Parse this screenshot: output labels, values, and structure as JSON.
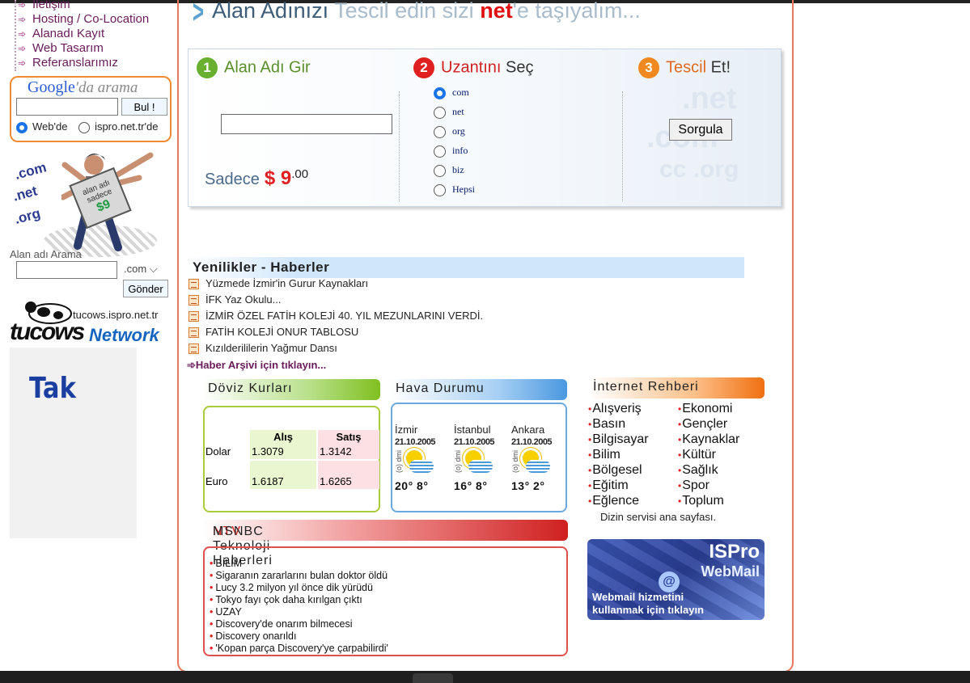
{
  "left_nav": {
    "items": [
      {
        "label": "İletişim"
      },
      {
        "label": "Hosting / Co-Location"
      },
      {
        "label": "Alanadı Kayıt"
      },
      {
        "label": "Web Tasarım"
      },
      {
        "label": "Referanslarımız"
      }
    ]
  },
  "google_search": {
    "logo_google": "Google",
    "logo_suffix": "'da arama",
    "button": "Bul !",
    "option_web": "Web'de",
    "option_site": "ispro.net.tr'de"
  },
  "promo": {
    "ext_com": ".com",
    "ext_net": ".net",
    "ext_org": ".org",
    "sign_line1": "alan adı",
    "sign_line2": "sadece",
    "sign_price": "$9"
  },
  "domain_search": {
    "label": "Alan adı Arama",
    "ext_select": ".com",
    "button": "Gönder"
  },
  "tucows": {
    "site": "tucows.ispro.net.tr",
    "word": "tucows",
    "net": "Network"
  },
  "ad": {
    "text": "Tak"
  },
  "slogan": {
    "part1": "Alan Adınızı",
    "part2": " Tescil edin sizi ",
    "net": "net",
    "part3": "'e taşıyalım..."
  },
  "registration": {
    "step1_num": "1",
    "step1_label": "Alan Adı Gir",
    "step2_num": "2",
    "step2_label": "Uzantını",
    "step2_bold": " Seç",
    "step3_num": "3",
    "step3_label": "Tescil",
    "step3_bold": " Et!",
    "price_label": "Sadece",
    "price_currency": "$ 9",
    "price_cents": ".00",
    "tlds": [
      "com",
      "net",
      "org",
      "info",
      "biz",
      "Hepsi"
    ],
    "selected_tld": "com",
    "button": "Sorgula",
    "watermark1": ".net",
    "watermark2": ".com",
    "watermark3": "cc .org"
  },
  "news": {
    "title": "Yenilikler - Haberler",
    "items": [
      "Yüzmede İzmir'in Gurur Kaynakları",
      "İFK Yaz Okulu...",
      "İZMİR ÖZEL FATİH KOLEJİ 40. YIL MEZUNLARINI VERDİ.",
      "FATİH KOLEJİ ONUR TABLOSU",
      "Kızılderililerin Yağmur Dansı"
    ],
    "archive": "Haber Arşivi için tıklayın..."
  },
  "doviz": {
    "title": "Döviz Kurları",
    "col_buy": "Alış",
    "col_sell": "Satış",
    "rows": [
      {
        "name": "Dolar",
        "buy": "1.3079",
        "sell": "1.3142"
      },
      {
        "name": "Euro",
        "buy": "1.6187",
        "sell": "1.6265"
      }
    ]
  },
  "hava": {
    "title": "Hava Durumu",
    "cities": [
      {
        "name": "İzmir",
        "date": "21.10.2005",
        "note": "(o) dmi",
        "temps": "20° 8°"
      },
      {
        "name": "İstanbul",
        "date": "21.10.2005",
        "note": "(o) dmi",
        "temps": "16° 8°"
      },
      {
        "name": "Ankara",
        "date": "21.10.2005",
        "note": "(o) dmi",
        "temps": "13° 2°"
      }
    ]
  },
  "rehber": {
    "title": "İnternet Rehberi",
    "col1": [
      "Alışveriş",
      "Basın",
      "Bilgisayar",
      "Bilim",
      "Bölgesel",
      "Eğitim",
      "Eğlence"
    ],
    "col2": [
      "Ekonomi",
      "Gençler",
      "Kaynaklar",
      "Kültür",
      "Sağlık",
      "Spor",
      "Toplum"
    ],
    "footer": "Dizin servisi ana sayfası."
  },
  "webmail": {
    "brand": "ISPro",
    "product": "WebMail",
    "line1": "Webmail hizmetini",
    "line2": "kullanmak için tıklayın"
  },
  "ntv": {
    "title_ntv": "NTV",
    "title_rest": "MSNBC Teknoloji Haberleri",
    "items": [
      "BİLİM",
      "Sigaranın zararlarını bulan doktor öldü",
      "Lucy 3.2 milyon yıl önce dik yürüdü",
      "Tokyo fayı çok daha kırılgan çıktı",
      "UZAY",
      "Discovery'de onarım bilmecesi",
      "Discovery onarıldı",
      "'Kopan parça Discovery'ye çarpabilirdi'"
    ]
  }
}
